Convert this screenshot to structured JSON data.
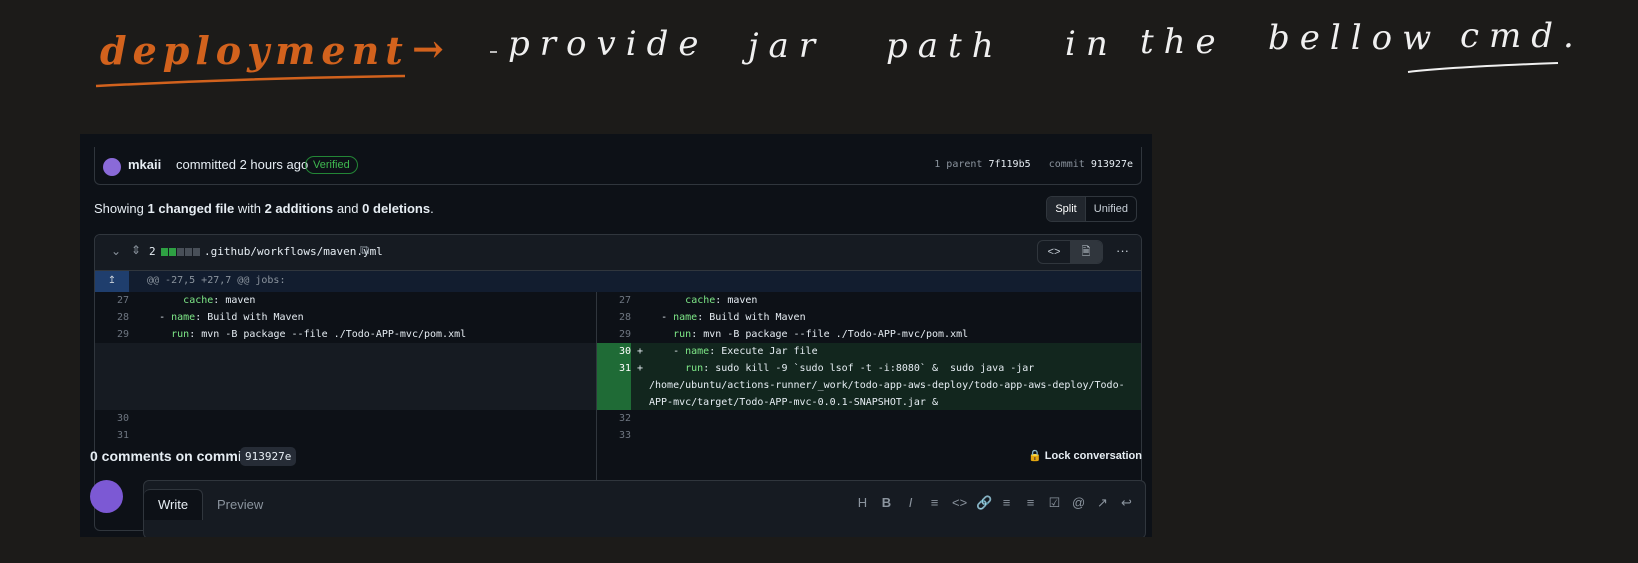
{
  "annotation": {
    "words_orange": [
      "deployment",
      "→"
    ],
    "words_white": [
      "provide",
      "jar",
      "path",
      "in",
      "the",
      "bellow",
      "cmd."
    ],
    "ink_orange": "#d2621d",
    "ink_white": "#f0f0f0"
  },
  "commit": {
    "author": "mkaii",
    "time_text": "committed 2 hours ago",
    "verified": "Verified",
    "parent_label": "1 parent",
    "parent_sha": "7f119b5",
    "commit_label": "commit",
    "commit_sha": "913927e"
  },
  "summary": {
    "showing": "Showing",
    "files": "1 changed file",
    "with": "with",
    "additions": "2 additions",
    "and": "and",
    "deletions": "0 deletions",
    "end": "."
  },
  "view_toggle": {
    "split": "Split",
    "unified": "Unified"
  },
  "file": {
    "count": "2",
    "name": ".github/workflows/maven.yml",
    "hunk": "@@ -27,5 +27,7 @@ jobs:",
    "left_lines": [
      {
        "num": "27",
        "key": "cache",
        "val": ": maven",
        "indent": "        "
      },
      {
        "num": "28",
        "key": "name",
        "val": ": Build with Maven",
        "indent": "    - "
      },
      {
        "num": "29",
        "key": "run",
        "val": ": mvn -B package --file ./Todo-APP-mvc/pom.xml",
        "indent": "      "
      }
    ],
    "left_tail": [
      {
        "num": "30"
      },
      {
        "num": "31"
      }
    ],
    "right_lines": [
      {
        "num": "27",
        "key": "cache",
        "val": ": maven",
        "indent": "        "
      },
      {
        "num": "28",
        "key": "name",
        "val": ": Build with Maven",
        "indent": "    - "
      },
      {
        "num": "29",
        "key": "run",
        "val": ": mvn -B package --file ./Todo-APP-mvc/pom.xml",
        "indent": "      "
      }
    ],
    "added": {
      "line30": {
        "num": "30",
        "sign": "+",
        "indent": "    - ",
        "key": "name",
        "val": ": Execute Jar file"
      },
      "line31": {
        "num": "31",
        "sign": "+",
        "indent": "      ",
        "key": "run",
        "val": ": sudo kill -9 `sudo lsof -t -i:8080` &  sudo java -jar"
      },
      "wrap1": "/home/ubuntu/actions-runner/_work/todo-app-aws-deploy/todo-app-aws-deploy/Todo-",
      "wrap2": "APP-mvc/target/Todo-APP-mvc-0.0.1-SNAPSHOT.jar &"
    },
    "right_tail": [
      {
        "num": "32"
      },
      {
        "num": "33"
      }
    ]
  },
  "comments": {
    "title": "0 comments on commit",
    "sha": "913927e",
    "lock": "Lock conversation",
    "write_tab": "Write",
    "preview_tab": "Preview"
  },
  "toolbar_icons": [
    "heading-icon",
    "bold-icon",
    "italic-icon",
    "quote-icon",
    "code-icon",
    "link-icon",
    "bulleted-list-icon",
    "numbered-list-icon",
    "task-list-icon",
    "mention-icon",
    "reference-icon",
    "reply-icon"
  ],
  "colors": {
    "background": "#1c1b19",
    "panel": "#0d1117",
    "verified": "#3fb950",
    "added_line": "#1f6b36"
  }
}
